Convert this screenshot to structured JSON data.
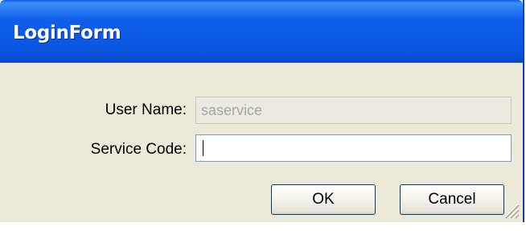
{
  "window": {
    "title": "LoginForm"
  },
  "form": {
    "username_label": "User Name:",
    "username_value": "saservice",
    "service_code_label": "Service Code:",
    "service_code_value": ""
  },
  "buttons": {
    "ok_label": "OK",
    "cancel_label": "Cancel"
  },
  "colors": {
    "titlebar_blue": "#0b5ae6",
    "face": "#ece9d8",
    "field_border": "#7f9db9"
  },
  "icons": {
    "resize_grip": "size-grip-icon"
  }
}
